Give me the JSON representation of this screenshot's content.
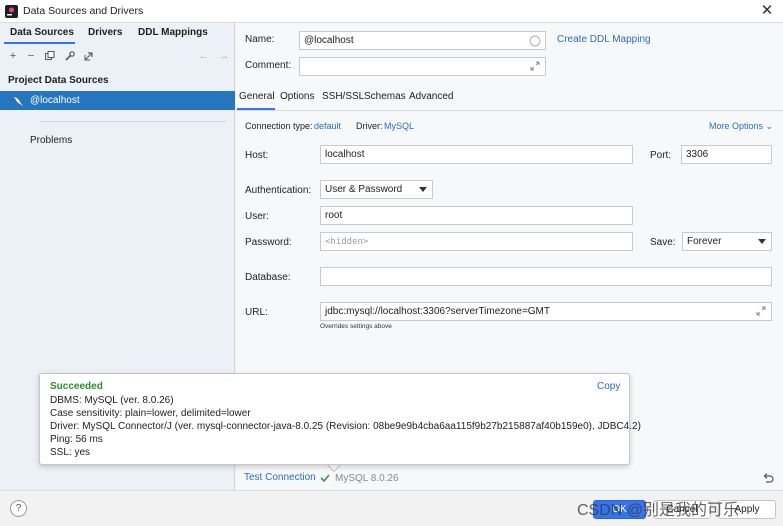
{
  "window": {
    "title": "Data Sources and Drivers"
  },
  "left": {
    "tabs": [
      {
        "label": "Data Sources"
      },
      {
        "label": "Drivers"
      },
      {
        "label": "DDL Mappings"
      }
    ],
    "toolbar_icons": [
      "plus-icon",
      "minus-icon",
      "duplicate-icon",
      "wrench-icon",
      "jump-icon",
      "back-arrow-icon",
      "forward-arrow-icon"
    ],
    "section_title": "Project Data Sources",
    "selected_item": "@localhost",
    "problems": "Problems"
  },
  "form": {
    "name_label": "Name:",
    "name_value": "@localhost",
    "create_ddl_mapping": "Create DDL Mapping",
    "comment_label": "Comment:",
    "comment_value": "",
    "tabs": [
      {
        "label": "General"
      },
      {
        "label": "Options"
      },
      {
        "label": "SSH/SSL"
      },
      {
        "label": "Schemas"
      },
      {
        "label": "Advanced"
      }
    ],
    "connection_type_label": "Connection type:",
    "connection_type_value": "default",
    "driver_label": "Driver:",
    "driver_value": "MySQL",
    "more_options": "More Options",
    "host_label": "Host:",
    "host_value": "localhost",
    "port_label": "Port:",
    "port_value": "3306",
    "auth_label": "Authentication:",
    "auth_value": "User & Password",
    "user_label": "User:",
    "user_value": "root",
    "password_label": "Password:",
    "password_placeholder": "<hidden>",
    "save_label": "Save:",
    "save_value": "Forever",
    "database_label": "Database:",
    "database_value": "",
    "url_label": "URL:",
    "url_value": "jdbc:mysql://localhost:3306?serverTimezone=GMT",
    "url_hint": "Overrides settings above"
  },
  "popup": {
    "status": "Succeeded",
    "copy": "Copy",
    "lines": [
      "DBMS: MySQL (ver. 8.0.26)",
      "Case sensitivity: plain=lower, delimited=lower",
      "Driver: MySQL Connector/J (ver. mysql-connector-java-8.0.25 (Revision: 08be9e9b4cba6aa115f9b27b215887af40b159e0), JDBC4.2)",
      "Ping: 56 ms",
      "SSL: yes"
    ]
  },
  "bottom": {
    "test_connection": "Test Connection",
    "mysql_version": "MySQL 8.0.26"
  },
  "footer": {
    "help": "?",
    "ok": "OK",
    "cancel": "Cancel",
    "apply": "Apply",
    "watermark": "CSDN @别是我的可乐"
  },
  "colors": {
    "accent": "#3574f0",
    "selection": "#2675bf",
    "link": "#2d6cc0",
    "success": "#2e8b2e"
  }
}
